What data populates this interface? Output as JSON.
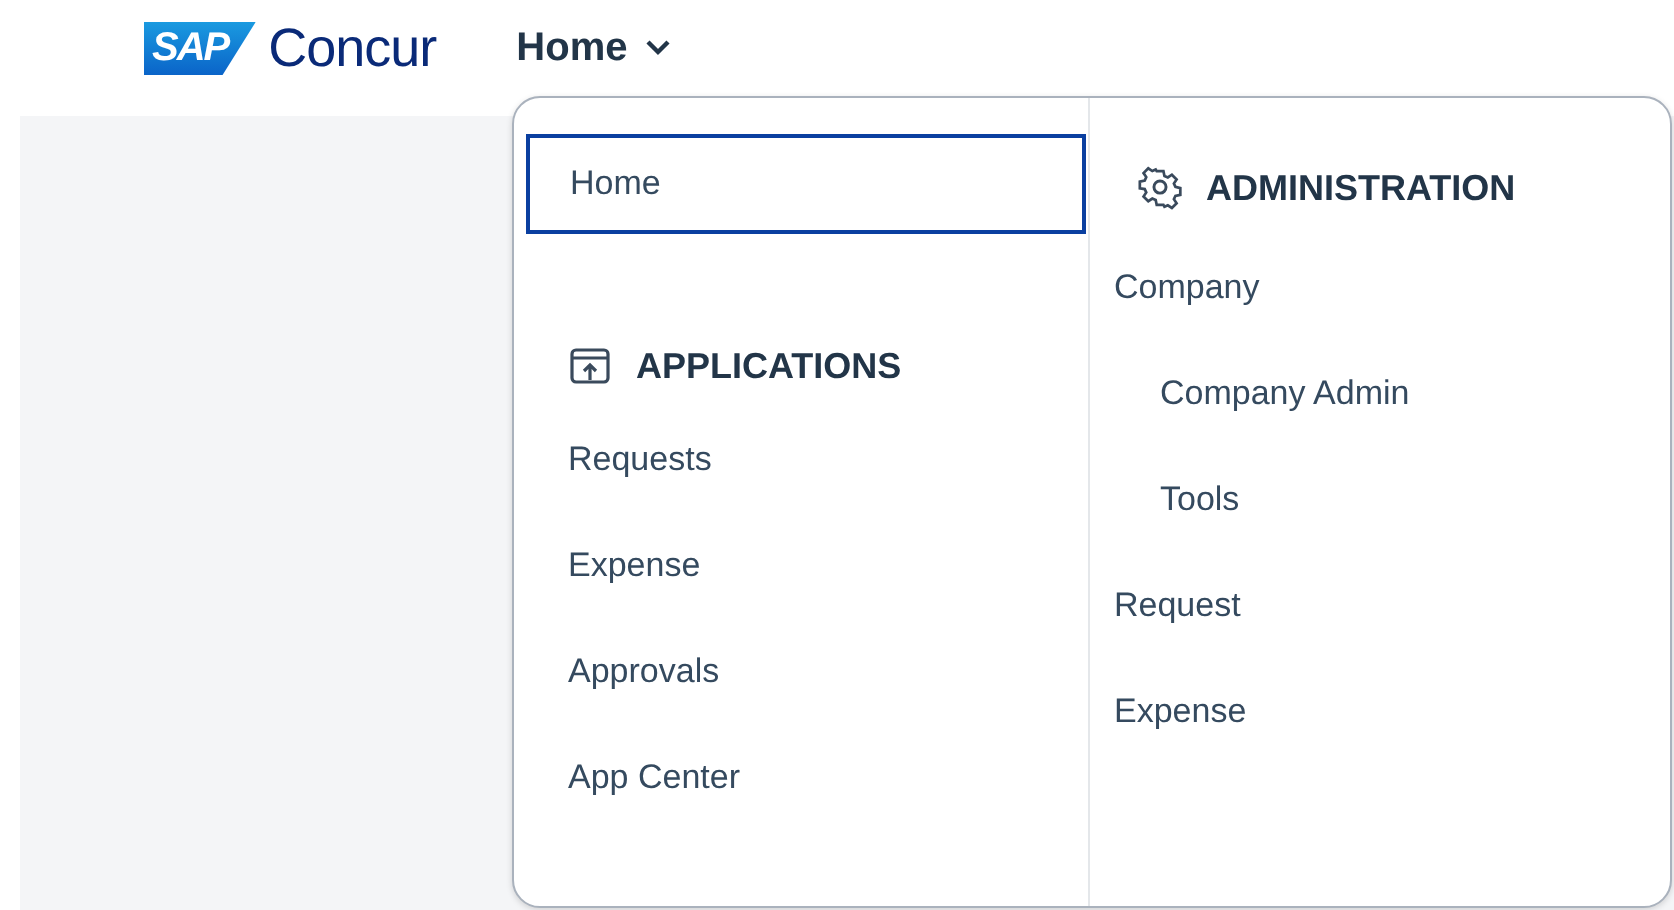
{
  "header": {
    "logo": "SAP",
    "brand": "Concur",
    "nav": {
      "label": "Home",
      "expanded": true
    }
  },
  "menu": {
    "home_item": {
      "label": "Home",
      "selected": true
    },
    "applications": {
      "title": "APPLICATIONS",
      "items": [
        {
          "label": "Requests"
        },
        {
          "label": "Expense"
        },
        {
          "label": "Approvals"
        },
        {
          "label": "App Center"
        }
      ]
    },
    "administration": {
      "title": "ADMINISTRATION",
      "items": [
        {
          "label": "Company",
          "children": [
            {
              "label": "Company Admin"
            },
            {
              "label": "Tools"
            }
          ]
        },
        {
          "label": "Request"
        },
        {
          "label": "Expense"
        }
      ]
    }
  }
}
